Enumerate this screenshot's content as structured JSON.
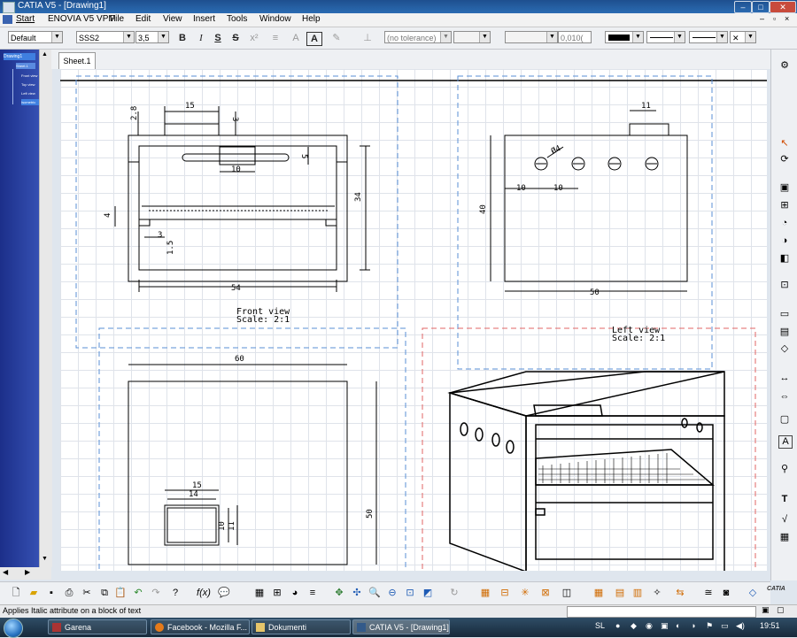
{
  "window": {
    "title": "CATIA V5 - [Drawing1]"
  },
  "menubar": {
    "items": [
      "Start",
      "ENOVIA V5 VPM",
      "File",
      "Edit",
      "View",
      "Insert",
      "Tools",
      "Window",
      "Help"
    ]
  },
  "toolbar": {
    "style": "Default",
    "font": "SSS2",
    "font_size": "3,5",
    "bold": "B",
    "italic": "I",
    "underline": "S",
    "strike": "S",
    "tolerance": "(no tolerance)",
    "precision": "0,010("
  },
  "tree": {
    "items": [
      "Drawing1",
      "Sheet.1",
      "Front view",
      "Top view",
      "Left view",
      "Isometric view"
    ]
  },
  "sheet_tab": "Sheet.1",
  "drawing": {
    "front_view": {
      "name": "Front view",
      "scale": "Scale:   2:1",
      "dims": {
        "d2_8": "2.8",
        "d15": "15",
        "d3": "3",
        "d5": "5",
        "d10": "10",
        "d34": "34",
        "d4": "4",
        "d3b": "3",
        "d1_5": "1.5",
        "d54": "54"
      }
    },
    "left_view": {
      "name": "Left view",
      "scale": "Scale:   2:1",
      "dims": {
        "d11": "11",
        "d_phi4": "Ø4",
        "d10a": "10",
        "d10b": "10",
        "d40": "40",
        "d50": "50"
      }
    },
    "top_view": {
      "dims": {
        "d60": "60",
        "d15": "15",
        "d14": "14",
        "d10": "10",
        "d11": "11",
        "d50": "50"
      }
    }
  },
  "status": {
    "text": "Applies Italic attribute on a block of text"
  },
  "taskbar": {
    "items": [
      "Garena",
      "Facebook - Mozilla F...",
      "Dokumenti",
      "CATIA V5 - [Drawing1]"
    ],
    "lang": "SL",
    "time": "19:51"
  },
  "brand": "CATIA"
}
